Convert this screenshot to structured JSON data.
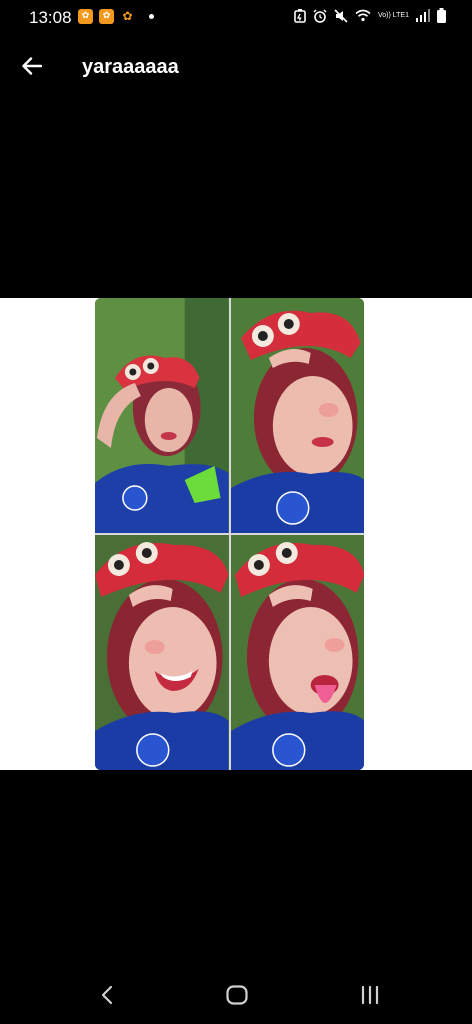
{
  "status_bar": {
    "time": "13:08",
    "notifications": [
      "app-notification-icon",
      "app-notification-icon",
      "app-notification-icon"
    ],
    "volte_label": "Vo)) LTE1"
  },
  "app_bar": {
    "title": "yaraaaaaa"
  },
  "colors": {
    "background": "#000000",
    "viewer_background": "#ffffff",
    "notification_accent": "#f39a1e"
  }
}
